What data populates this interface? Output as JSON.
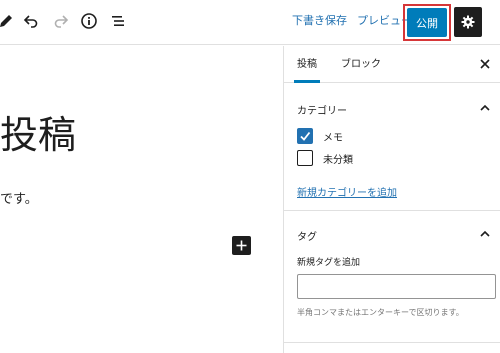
{
  "toolbar": {
    "save_draft": "下書き保存",
    "preview": "プレビュー",
    "publish": "公開",
    "icons": [
      "pencil-icon",
      "undo-icon",
      "redo-icon",
      "info-icon",
      "list-view-icon",
      "gear-icon"
    ]
  },
  "editor": {
    "title": "投稿",
    "paragraph": "です。"
  },
  "sidebar": {
    "tabs": [
      {
        "label": "投稿",
        "active": true
      },
      {
        "label": "ブロック",
        "active": false
      }
    ],
    "categories": {
      "title": "カテゴリー",
      "items": [
        {
          "label": "メモ",
          "checked": true
        },
        {
          "label": "未分類",
          "checked": false
        }
      ],
      "add_link": "新規カテゴリーを追加"
    },
    "tags": {
      "title": "タグ",
      "input_label": "新規タグを追加",
      "input_value": "",
      "help": "半角コンマまたはエンターキーで区切ります。"
    }
  },
  "colors": {
    "accent": "#007cba",
    "link": "#2271b1",
    "highlight_outline": "#d63638",
    "dark": "#1e1e1e"
  }
}
